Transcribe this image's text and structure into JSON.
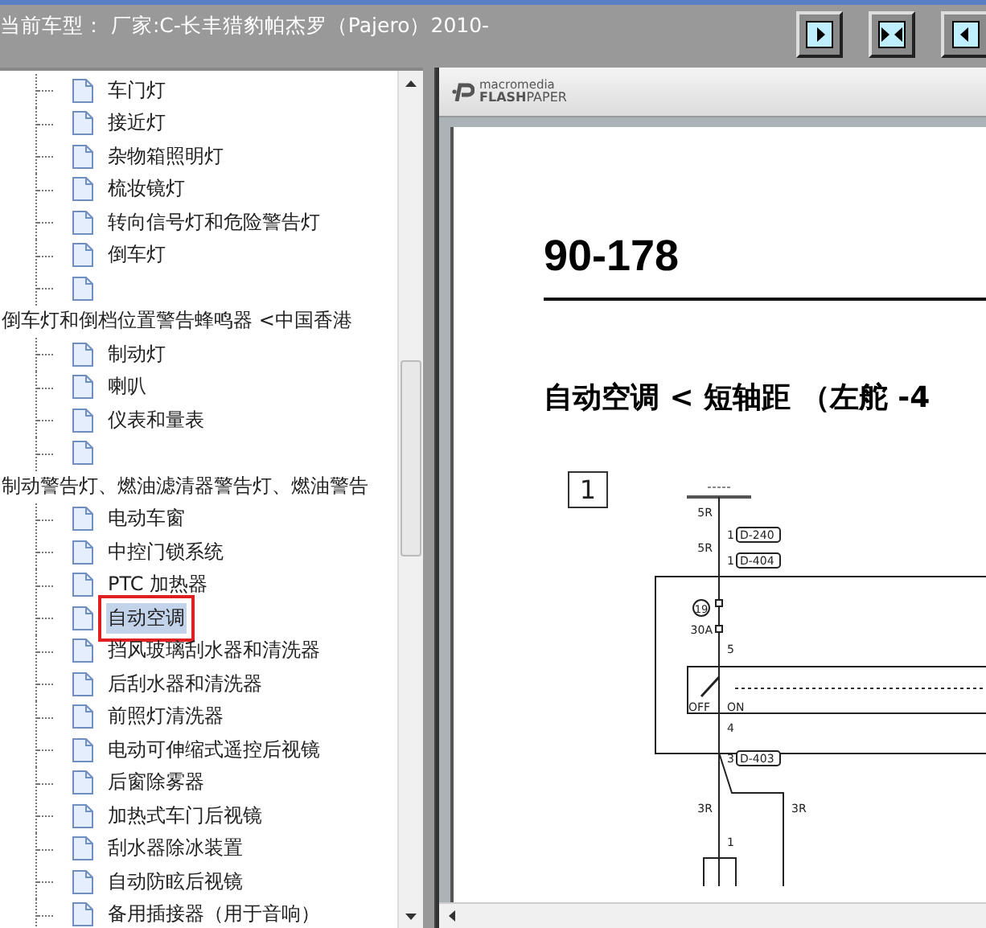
{
  "title_bar": {
    "title": "当前车型： 厂家:C-长丰猎豹帕杰罗（Pajero）2010-"
  },
  "toolbar": [
    {
      "kind": "right"
    },
    {
      "kind": "both"
    },
    {
      "kind": "left"
    }
  ],
  "tree": [
    {
      "children": [
        {
          "kind": "page",
          "label": "车门灯",
          "selected": false,
          "marked": false
        },
        {
          "kind": "page",
          "label": "接近灯",
          "selected": false,
          "marked": false
        },
        {
          "kind": "page",
          "label": "杂物箱照明灯",
          "selected": false,
          "marked": false
        },
        {
          "kind": "page",
          "label": "梳妆镜灯",
          "selected": false,
          "marked": false
        },
        {
          "kind": "page",
          "label": "转向信号灯和危险警告灯",
          "selected": false,
          "marked": false
        },
        {
          "kind": "page",
          "label": "倒车灯",
          "selected": false,
          "marked": false
        },
        {
          "kind": "blank"
        }
      ]
    },
    {
      "label": "倒车灯和倒档位置警告蜂鸣器 <中国香港",
      "children": [
        {
          "kind": "page",
          "label": "制动灯",
          "selected": false,
          "marked": false
        },
        {
          "kind": "page",
          "label": "喇叭",
          "selected": false,
          "marked": false
        },
        {
          "kind": "page",
          "label": "仪表和量表",
          "selected": false,
          "marked": false
        },
        {
          "kind": "blank"
        }
      ]
    },
    {
      "label": "制动警告灯、燃油滤清器警告灯、燃油警告",
      "children": [
        {
          "kind": "page",
          "label": "电动车窗",
          "selected": false,
          "marked": false
        },
        {
          "kind": "page",
          "label": "中控门锁系统",
          "selected": false,
          "marked": false
        },
        {
          "kind": "page",
          "label": "PTC 加热器",
          "selected": false,
          "marked": false
        },
        {
          "kind": "page",
          "label": "自动空调",
          "selected": true,
          "marked": true
        },
        {
          "kind": "page",
          "label": "挡风玻璃刮水器和清洗器",
          "selected": false,
          "marked": false
        },
        {
          "kind": "page",
          "label": "后刮水器和清洗器",
          "selected": false,
          "marked": false
        },
        {
          "kind": "page",
          "label": "前照灯清洗器",
          "selected": false,
          "marked": false
        },
        {
          "kind": "page",
          "label": "电动可伸缩式遥控后视镜",
          "selected": false,
          "marked": false
        },
        {
          "kind": "page",
          "label": "后窗除雾器",
          "selected": false,
          "marked": false
        },
        {
          "kind": "page",
          "label": "加热式车门后视镜",
          "selected": false,
          "marked": false
        },
        {
          "kind": "page",
          "label": "刮水器除冰装置",
          "selected": false,
          "marked": false
        },
        {
          "kind": "page",
          "label": "自动防眩后视镜",
          "selected": false,
          "marked": false
        },
        {
          "kind": "page",
          "label": "备用插接器（用于音响）",
          "selected": false,
          "marked": false
        }
      ]
    }
  ],
  "viewer": {
    "brand_top": "macromedia",
    "brand_bold": "FLASH",
    "brand_rest": "PAPER",
    "page_number": "90-178",
    "heading": "自动空调 < 短轴距 （左舵 -4",
    "diagram": {
      "box_label": "1",
      "labels": [
        "5R",
        "1",
        "D-240",
        "5R",
        "1",
        "D-404",
        "19",
        "30A",
        "5",
        "OFF",
        "ON",
        "4",
        "3",
        "D-403",
        "3R",
        "3R",
        "1"
      ]
    }
  }
}
